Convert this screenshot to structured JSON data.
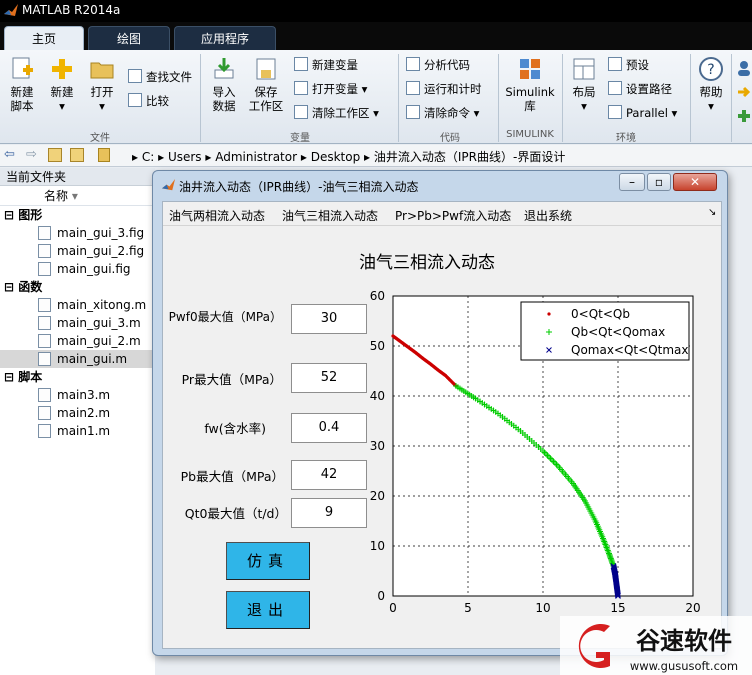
{
  "app": {
    "title": "MATLAB R2014a"
  },
  "tabs": [
    "主页",
    "绘图",
    "应用程序"
  ],
  "ribbon": {
    "file": {
      "new_script": "新建\n脚本",
      "new": "新建",
      "open": "打开",
      "find_files": "查找文件",
      "compare": "比较",
      "group": "文件"
    },
    "variable": {
      "import": "导入\n数据",
      "save_ws": "保存\n工作区",
      "new_var": "新建变量",
      "open_var": "打开变量",
      "clear_ws": "清除工作区",
      "group": "变量"
    },
    "code": {
      "analyze": "分析代码",
      "run_time": "运行和计时",
      "clear_cmd": "清除命令",
      "group": "代码"
    },
    "simulink": {
      "lib": "Simulink\n库",
      "group": "SIMULINK"
    },
    "env": {
      "layout": "布局",
      "prefs": "预设",
      "set_path": "设置路径",
      "parallel": "Parallel",
      "group": "环境"
    },
    "resources": {
      "help": "帮助"
    }
  },
  "address": {
    "parts": [
      "C:",
      "Users",
      "Administrator",
      "Desktop",
      "油井流入动态（IPR曲线）-界面设计"
    ]
  },
  "current_folder": {
    "title": "当前文件夹",
    "name_col": "名称",
    "sections": [
      {
        "label": "图形",
        "items": [
          "main_gui_3.fig",
          "main_gui_2.fig",
          "main_gui.fig"
        ]
      },
      {
        "label": "函数",
        "items": [
          "main_xitong.m",
          "main_gui_3.m",
          "main_gui_2.m",
          "main_gui.m"
        ]
      },
      {
        "label": "脚本",
        "items": [
          "main3.m",
          "main2.m",
          "main1.m"
        ]
      }
    ],
    "selected": "main_gui.m"
  },
  "figure": {
    "title": "油井流入动态（IPR曲线）-油气三相流入动态",
    "menus": [
      "油气两相流入动态",
      "油气三相流入动态",
      "Pr>Pb>Pwf流入动态",
      "退出系统"
    ],
    "heading": "油气三相流入动态",
    "fields": [
      {
        "label": "Pwf0最大值（MPa）",
        "value": "30"
      },
      {
        "label": "Pr最大值（MPa）",
        "value": "52"
      },
      {
        "label": "fw(含水率)",
        "value": "0.4"
      },
      {
        "label": "Pb最大值（MPa）",
        "value": "42"
      },
      {
        "label": "Qt0最大值（t/d）",
        "value": "9"
      }
    ],
    "buttons": {
      "simulate": "仿真",
      "exit": "退出"
    }
  },
  "chart_data": {
    "type": "scatter",
    "xlim": [
      0,
      20
    ],
    "ylim": [
      0,
      60
    ],
    "x_ticks": [
      0,
      5,
      10,
      15,
      20
    ],
    "y_ticks": [
      0,
      10,
      20,
      30,
      40,
      50,
      60
    ],
    "grid": true,
    "legend_position": "top-right",
    "series": [
      {
        "name": "0<Qt<Qb",
        "color": "#cc0000",
        "marker": "dot",
        "x": [
          0,
          0.5,
          1,
          1.5,
          2,
          2.5,
          3,
          3.5,
          4.2
        ],
        "y": [
          52,
          50.9,
          49.8,
          48.7,
          47.5,
          46.4,
          45.2,
          44.1,
          42
        ]
      },
      {
        "name": "Qb<Qt<Qomax",
        "color": "#00cc00",
        "marker": "plus",
        "x": [
          4.2,
          5.5,
          7,
          8.5,
          10,
          11,
          12,
          12.8,
          13.5,
          14,
          14.4,
          14.7
        ],
        "y": [
          42,
          39.5,
          36.5,
          33,
          29,
          26,
          22.5,
          19,
          15,
          11.5,
          8.5,
          6
        ]
      },
      {
        "name": "Qomax<Qt<Qtmax",
        "color": "#00008b",
        "marker": "x",
        "x": [
          14.7,
          14.8,
          14.85,
          14.9,
          14.95,
          15
        ],
        "y": [
          6,
          4.5,
          3.5,
          2.3,
          1.2,
          0
        ]
      }
    ]
  },
  "watermark": {
    "brand": "谷速软件",
    "url": "www.gususoft.com"
  },
  "colors": {
    "accent": "#2fb5e8",
    "title_bg": "#000000",
    "window_frame": "#c5d7ea"
  }
}
